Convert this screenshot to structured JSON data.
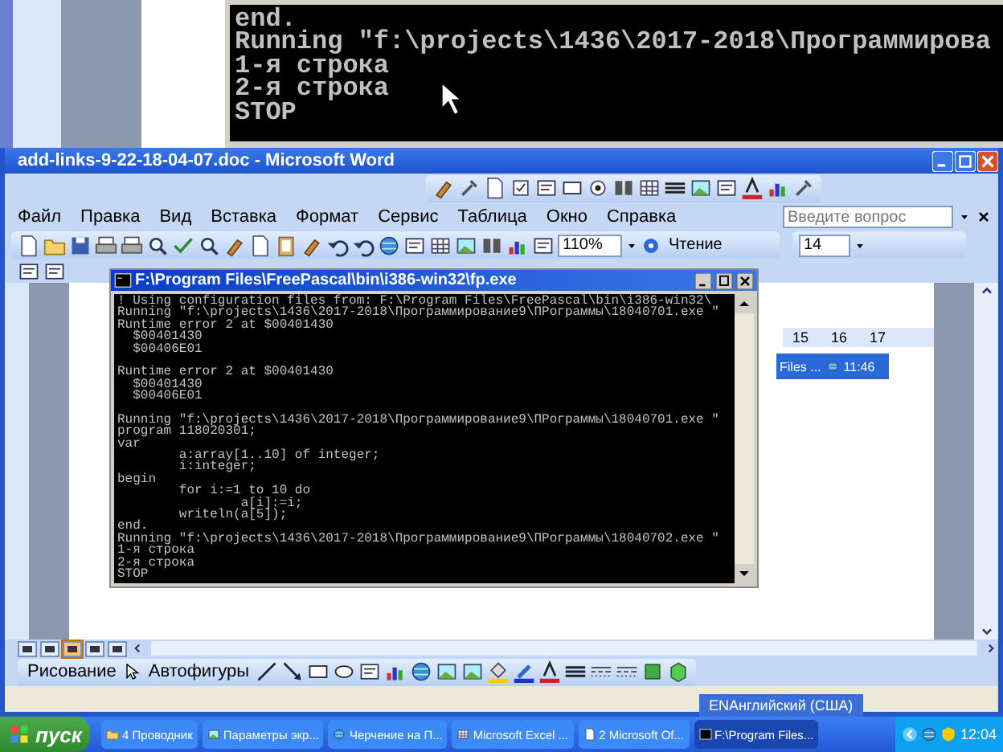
{
  "background_console": {
    "lines": [
      "end.",
      "Running \"f:\\projects\\1436\\2017-2018\\Программирова",
      "1-я строка",
      "2-я строка",
      "STOP"
    ]
  },
  "word_window": {
    "title": "add-links-9-22-18-04-07.doc - Microsoft Word",
    "menu": [
      "Файл",
      "Правка",
      "Вид",
      "Вставка",
      "Формат",
      "Сервис",
      "Таблица",
      "Окно",
      "Справка"
    ],
    "question_field": {
      "placeholder": "Введите вопрос"
    },
    "zoom": "110%",
    "reading_button": "Чтение",
    "font_size": "14",
    "ruler_labels": [
      "15",
      "16",
      "17"
    ],
    "embedded_screenshot": {
      "task": "Files ...",
      "time": "11:46"
    },
    "view_buttons": [
      {
        "selected": false
      },
      {
        "selected": false
      },
      {
        "selected": true
      },
      {
        "selected": false
      },
      {
        "selected": false
      }
    ],
    "drawing_toolbar": {
      "draw_menu": "Рисование",
      "autoshapes_menu": "Автофигуры"
    }
  },
  "console_window": {
    "title": "F:\\Program Files\\FreePascal\\bin\\i386-win32\\fp.exe",
    "blocks": [
      [
        "! Using configuration files from: F:\\Program Files\\FreePascal\\bin\\i386-win32\\",
        "Running \"f:\\projects\\1436\\2017-2018\\Программирование9\\ПРограммы\\18040701.exe \"",
        "Runtime error 2 at $00401430",
        "  $00401430",
        "  $00406E01"
      ],
      [
        "Runtime error 2 at $00401430",
        "  $00401430",
        "  $00406E01"
      ],
      [
        "Running \"f:\\projects\\1436\\2017-2018\\Программирование9\\ПРограммы\\18040701.exe \"",
        "program 118020301;",
        "var",
        "        a:array[1..10] of integer;",
        "        i:integer;",
        "begin",
        "        for i:=1 to 10 do",
        "                a[i]:=i;",
        "        writeln(a[5]);",
        "end.",
        "Running \"f:\\projects\\1436\\2017-2018\\Программирование9\\ПРограммы\\18040702.exe \"",
        "1-я строка",
        "2-я строка",
        "STOP"
      ]
    ]
  },
  "language_bar": "ENАнглийский (США)",
  "taskbar": {
    "start": "пуск",
    "tasks": [
      {
        "label": "4 Проводник",
        "selected": false
      },
      {
        "label": "Параметры экр...",
        "selected": false
      },
      {
        "label": "Черчение на П...",
        "selected": false
      },
      {
        "label": "Microsoft Excel ...",
        "selected": false
      },
      {
        "label": "2 Microsoft Of...",
        "selected": false
      },
      {
        "label": "F:\\Program Files...",
        "selected": true
      }
    ],
    "clock": "12:04"
  }
}
